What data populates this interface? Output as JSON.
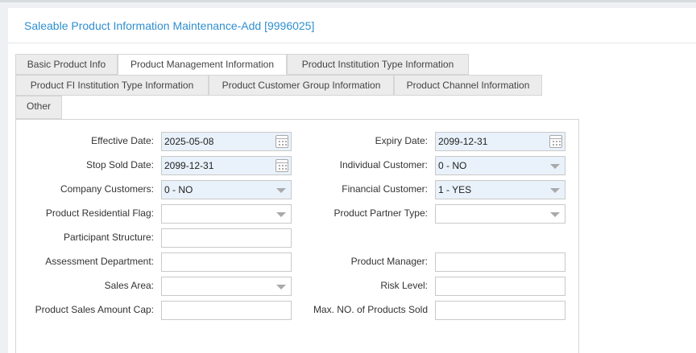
{
  "page": {
    "title": "Saleable Product Information Maintenance-Add [9996025]"
  },
  "tabs": [
    {
      "label": "Basic Product Info"
    },
    {
      "label": "Product Management Information"
    },
    {
      "label": "Product Institution Type Information"
    },
    {
      "label": "Product FI Institution Type Information"
    },
    {
      "label": "Product Customer Group Information"
    },
    {
      "label": "Product Channel Information"
    },
    {
      "label": "Other"
    }
  ],
  "active_tab": "Product Management Information",
  "form": {
    "effective_date": {
      "label": "Effective Date:",
      "value": "2025-05-08",
      "icon": "calendar-icon"
    },
    "expiry_date": {
      "label": "Expiry Date:",
      "value": "2099-12-31",
      "icon": "calendar-icon"
    },
    "stop_sold_date": {
      "label": "Stop Sold Date:",
      "value": "2099-12-31",
      "icon": "calendar-icon"
    },
    "individual_customer": {
      "label": "Individual Customer:",
      "value": "0 - NO",
      "icon": "chevron-down-icon"
    },
    "company_customers": {
      "label": "Company Customers:",
      "value": "0 - NO",
      "icon": "chevron-down-icon"
    },
    "financial_customer": {
      "label": "Financial Customer:",
      "value": "1 - YES",
      "icon": "chevron-down-icon"
    },
    "product_residential_flag": {
      "label": "Product Residential Flag:",
      "value": "",
      "icon": "chevron-down-icon"
    },
    "product_partner_type": {
      "label": "Product Partner Type:",
      "value": "",
      "icon": "chevron-down-icon"
    },
    "participant_structure": {
      "label": "Participant Structure:",
      "value": ""
    },
    "assessment_department": {
      "label": "Assessment Department:",
      "value": ""
    },
    "product_manager": {
      "label": "Product Manager:",
      "value": ""
    },
    "sales_area": {
      "label": "Sales Area:",
      "value": "",
      "icon": "chevron-down-icon"
    },
    "risk_level": {
      "label": "Risk Level:",
      "value": ""
    },
    "product_sales_amount_cap": {
      "label": "Product Sales Amount Cap:",
      "value": ""
    },
    "max_no_of_products_sold": {
      "label": "Max. NO. of Products Sold",
      "value": ""
    }
  },
  "colors": {
    "title": "#2f8fcf",
    "filled_field": "#e9f2fb",
    "tab_inactive": "#ececec",
    "page_background": "#eef0f3"
  }
}
